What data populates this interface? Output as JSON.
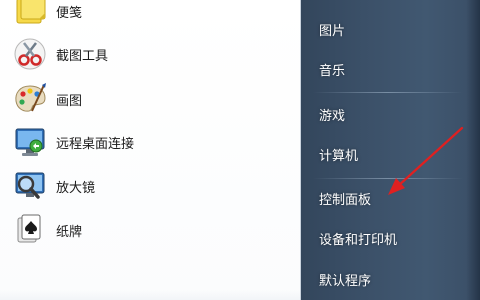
{
  "programs": [
    {
      "label": "便笺",
      "icon": "sticky-notes-icon"
    },
    {
      "label": "截图工具",
      "icon": "snipping-tool-icon"
    },
    {
      "label": "画图",
      "icon": "paint-palette-icon"
    },
    {
      "label": "远程桌面连接",
      "icon": "remote-desktop-icon"
    },
    {
      "label": "放大镜",
      "icon": "magnifier-icon"
    },
    {
      "label": "纸牌",
      "icon": "solitaire-cards-icon"
    }
  ],
  "places": [
    {
      "label": "图片"
    },
    {
      "label": "音乐"
    },
    {
      "label": "游戏"
    },
    {
      "label": "计算机"
    },
    {
      "label": "控制面板"
    },
    {
      "label": "设备和打印机"
    },
    {
      "label": "默认程序"
    }
  ],
  "colors": {
    "right_panel": "#3b5068",
    "annotation_arrow": "#e02020"
  }
}
